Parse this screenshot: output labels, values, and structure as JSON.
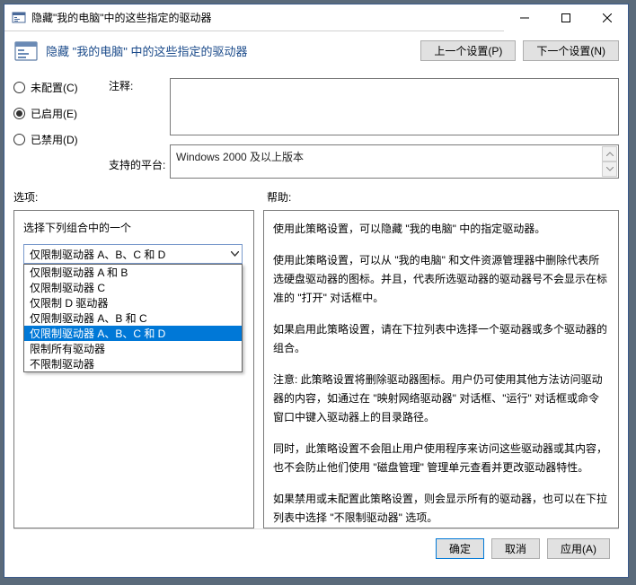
{
  "window": {
    "title": "隐藏\"我的电脑\"中的这些指定的驱动器",
    "policy_name": "隐藏 \"我的电脑\" 中的这些指定的驱动器"
  },
  "nav": {
    "prev": "上一个设置(P)",
    "next": "下一个设置(N)"
  },
  "state": {
    "not_configured": "未配置(C)",
    "enabled": "已启用(E)",
    "disabled": "已禁用(D)",
    "selected": "enabled"
  },
  "labels": {
    "comment": "注释:",
    "supported": "支持的平台:",
    "options": "选项:",
    "help": "帮助:"
  },
  "fields": {
    "comment_value": "",
    "supported_value": "Windows 2000 及以上版本"
  },
  "options": {
    "prompt": "选择下列组合中的一个",
    "selected": "仅限制驱动器 A、B、C 和 D",
    "items": [
      "仅限制驱动器 A 和 B",
      "仅限制驱动器 C",
      "仅限制 D 驱动器",
      "仅限制驱动器 A、B 和 C",
      "仅限制驱动器 A、B、C 和 D",
      "限制所有驱动器",
      "不限制驱动器"
    ]
  },
  "help": {
    "p1": "使用此策略设置，可以隐藏 \"我的电脑\" 中的指定驱动器。",
    "p2": "使用此策略设置，可以从 \"我的电脑\" 和文件资源管理器中删除代表所选硬盘驱动器的图标。并且，代表所选驱动器的驱动器号不会显示在标准的 \"打开\" 对话框中。",
    "p3": "如果启用此策略设置，请在下拉列表中选择一个驱动器或多个驱动器的组合。",
    "p4": "注意: 此策略设置将删除驱动器图标。用户仍可使用其他方法访问驱动器的内容，如通过在 \"映射网络驱动器\" 对话框、\"运行\" 对话框或命令窗口中键入驱动器上的目录路径。",
    "p5": "同时，此策略设置不会阻止用户使用程序来访问这些驱动器或其内容，也不会防止他们使用 \"磁盘管理\" 管理单元查看并更改驱动器特性。",
    "p6": "如果禁用或未配置此策略设置，则会显示所有的驱动器，也可以在下拉列表中选择 \"不限制驱动器\" 选项。"
  },
  "footer": {
    "ok": "确定",
    "cancel": "取消",
    "apply": "应用(A)"
  }
}
